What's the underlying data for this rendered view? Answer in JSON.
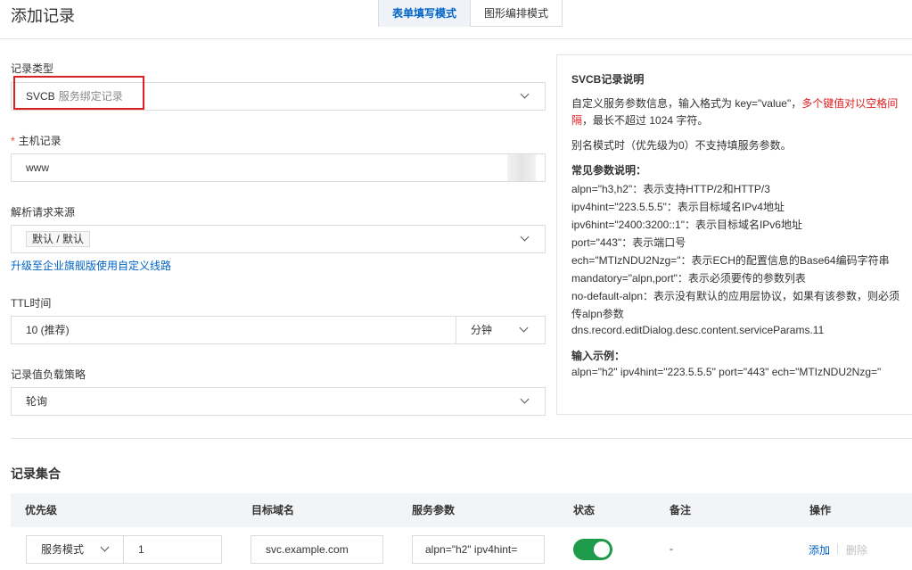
{
  "header": {
    "title": "添加记录",
    "tabs": [
      {
        "label": "表单填写模式",
        "active": true
      },
      {
        "label": "图形编排模式",
        "active": false
      }
    ]
  },
  "form": {
    "record_type": {
      "label": "记录类型",
      "value": "SVCB",
      "hint": "服务绑定记录"
    },
    "host": {
      "label": "主机记录",
      "required_mark": "*",
      "value": "www"
    },
    "resolve_source": {
      "label": "解析请求来源",
      "value": "默认 / 默认",
      "link": "升级至企业旗舰版使用自定义线路"
    },
    "ttl": {
      "label": "TTL时间",
      "value": "10 (推荐)",
      "unit": "分钟"
    },
    "load_strategy": {
      "label": "记录值负载策略",
      "value": "轮询"
    }
  },
  "desc": {
    "title": "SVCB记录说明",
    "intro_prefix": "自定义服务参数信息，输入格式为 key=\"value\"，",
    "intro_red": "多个键值对以空格间",
    "intro_line2_red": "隔",
    "intro_line2_rest": "，最长不超过 1024 字符。",
    "alias_note": "别名模式时（优先级为0）不支持填服务参数。",
    "params_title": "常见参数说明：",
    "params": [
      "alpn=\"h3,h2\"：表示支持HTTP/2和HTTP/3",
      "ipv4hint=\"223.5.5.5\"：表示目标域名IPv4地址",
      "ipv6hint=\"2400:3200::1\"：表示目标域名IPv6地址",
      "port=\"443\"：表示端口号",
      "ech=\"MTIzNDU2Nzg=\"：表示ECH的配置信息的Base64编码字符串",
      "mandatory=\"alpn,port\"：表示必须要传的参数列表",
      "no-default-alpn：表示没有默认的应用层协议，如果有该参数，则必须",
      "传alpn参数",
      "dns.record.editDialog.desc.content.serviceParams.11"
    ],
    "example_title": "输入示例：",
    "example": "alpn=\"h2\" ipv4hint=\"223.5.5.5\" port=\"443\" ech=\"MTIzNDU2Nzg=\""
  },
  "records": {
    "title": "记录集合",
    "columns": [
      "优先级",
      "目标域名",
      "服务参数",
      "状态",
      "备注",
      "操作"
    ],
    "rows": [
      {
        "mode": "服务模式",
        "priority": "1",
        "target": "svc.example.com",
        "params": "alpn=\"h2\" ipv4hint=",
        "status_on": true,
        "remark": "-",
        "op_add": "添加",
        "op_delete": "删除"
      }
    ]
  },
  "colors": {
    "accent": "#0064c8",
    "danger": "#e02020",
    "toggle_on": "#1e9b4a"
  }
}
